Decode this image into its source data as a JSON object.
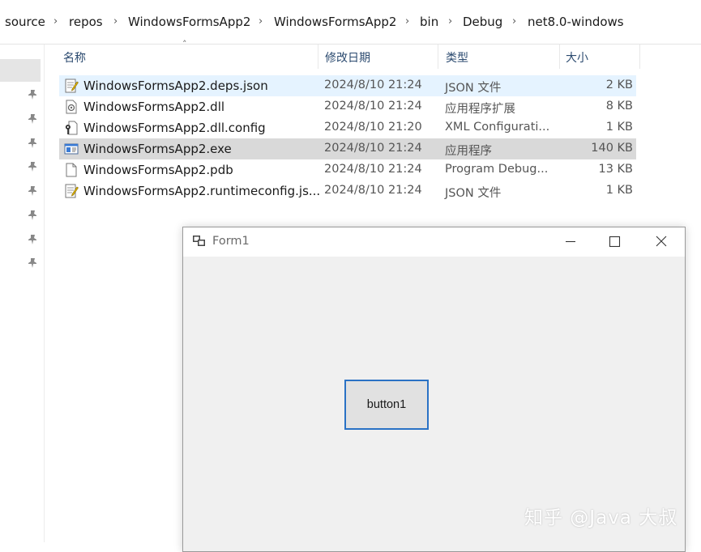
{
  "breadcrumb": [
    "source",
    "repos",
    "WindowsFormsApp2",
    "WindowsFormsApp2",
    "bin",
    "Debug",
    "net8.0-windows"
  ],
  "columns": {
    "name": "名称",
    "date": "修改日期",
    "type": "类型",
    "size": "大小"
  },
  "files": [
    {
      "name": "WindowsFormsApp2.deps.json",
      "date": "2024/8/10 21:24",
      "type": "JSON 文件",
      "size": "2 KB",
      "icon": "json-file-icon"
    },
    {
      "name": "WindowsFormsApp2.dll",
      "date": "2024/8/10 21:24",
      "type": "应用程序扩展",
      "size": "8 KB",
      "icon": "dll-file-icon"
    },
    {
      "name": "WindowsFormsApp2.dll.config",
      "date": "2024/8/10 21:20",
      "type": "XML Configurati...",
      "size": "1 KB",
      "icon": "config-file-icon"
    },
    {
      "name": "WindowsFormsApp2.exe",
      "date": "2024/8/10 21:24",
      "type": "应用程序",
      "size": "140 KB",
      "icon": "exe-file-icon"
    },
    {
      "name": "WindowsFormsApp2.pdb",
      "date": "2024/8/10 21:24",
      "type": "Program Debug...",
      "size": "13 KB",
      "icon": "pdb-file-icon"
    },
    {
      "name": "WindowsFormsApp2.runtimeconfig.js...",
      "date": "2024/8/10 21:24",
      "type": "JSON 文件",
      "size": "1 KB",
      "icon": "json-file-icon"
    }
  ],
  "form": {
    "title": "Form1",
    "button_label": "button1"
  },
  "watermark": "知乎 @Java 大叔",
  "colors": {
    "accent": "#2a72c5",
    "hover_row": "#e5f3ff",
    "selected_row": "#d9d9d9",
    "form_bg": "#f0f0f0"
  }
}
